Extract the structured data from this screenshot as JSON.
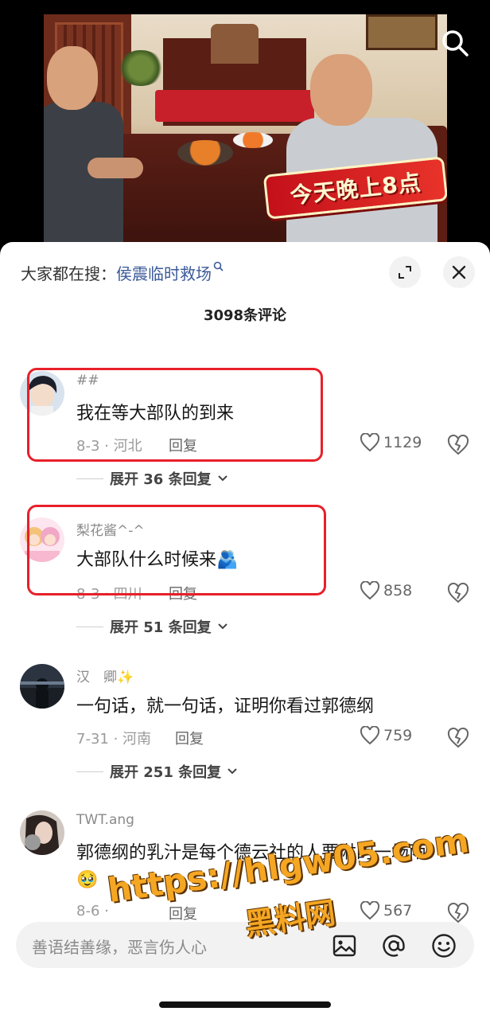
{
  "video": {
    "banner_text": "今天晚上8点"
  },
  "sheet": {
    "hot_search_prefix": "大家都在搜：",
    "hot_search_term": "侯震临时救场",
    "comment_count": "3098条评论"
  },
  "comments": [
    {
      "name": "##",
      "text": "我在等大部队的到来",
      "date_location": "8-3 · 河北",
      "reply_label": "回复",
      "likes": "1129",
      "expand_label": "展开 36 条回复"
    },
    {
      "name": "梨花酱^-^",
      "text": "大部队什么时候来🫂",
      "date_location": "8-3 · 四川",
      "reply_label": "回复",
      "likes": "858",
      "expand_label": "展开 51 条回复"
    },
    {
      "name": "汉　卿✨",
      "text": "一句话，就一句话，证明你看过郭德纲",
      "date_location": "7-31 · 河南",
      "reply_label": "回复",
      "likes": "759",
      "expand_label": "展开 251 条回复"
    },
    {
      "name": "TWT.ang",
      "text_line1": "郭德纲的乳汁是每个德云社的人要淋的一场雨",
      "text_line2": "🥹",
      "date_location": "8-6 ·",
      "reply_label": "回复",
      "likes": "567"
    }
  ],
  "input": {
    "placeholder": "善语结善缘，恶言伤人心"
  },
  "watermark": {
    "url": "https://hlgw05.com",
    "name": "黑料网"
  },
  "colors": {
    "highlight": "#e8202a",
    "hot_search_link": "#3c5a99",
    "watermark": "#f5a623"
  }
}
